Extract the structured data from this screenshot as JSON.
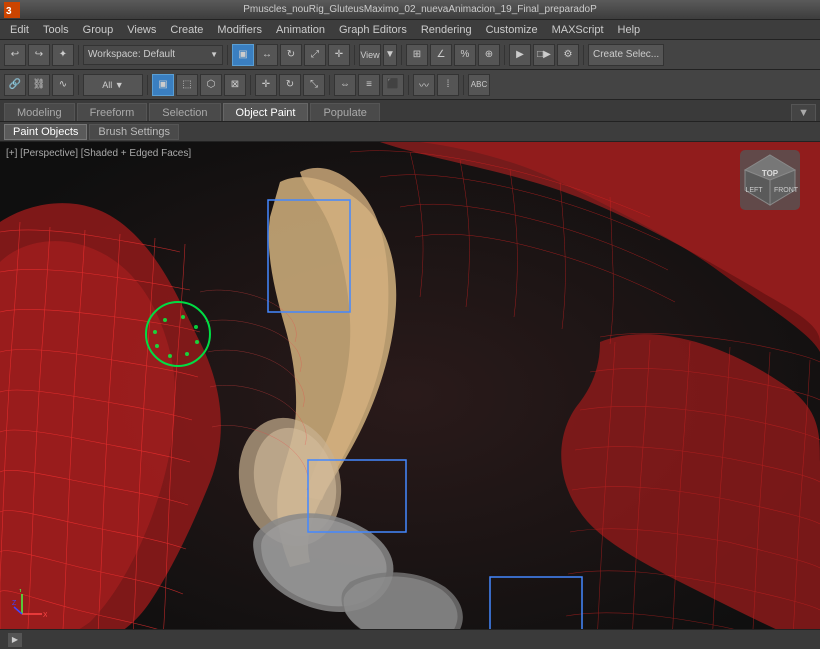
{
  "titlebar": {
    "title": "Pmuscles_nouRig_GluteusMaximo_02_nuevaAnimacion_19_Final_preparadoP"
  },
  "menubar": {
    "items": [
      "Edit",
      "Tools",
      "Group",
      "Views",
      "Create",
      "Modifiers",
      "Animation",
      "Graph Editors",
      "Rendering",
      "Customize",
      "MAXScript",
      "Help"
    ]
  },
  "toolbar1": {
    "workspace_label": "Workspace: Default",
    "create_selection_label": "Create Selec..."
  },
  "toolbar2": {
    "view_label": "View"
  },
  "mode_tabs": {
    "items": [
      "Modeling",
      "Freeform",
      "Selection",
      "Object Paint",
      "Populate"
    ],
    "active": "Object Paint",
    "dropdown_label": "▼"
  },
  "sub_tabs": {
    "items": [
      "Paint Objects",
      "Brush Settings"
    ],
    "active": "Paint Objects"
  },
  "viewport": {
    "label": "[+] [Perspective] [Shaded + Edged Faces]",
    "nav_cube_label": "LEFT"
  },
  "axis": {
    "x": "X",
    "y": "Y",
    "z": "Z"
  }
}
